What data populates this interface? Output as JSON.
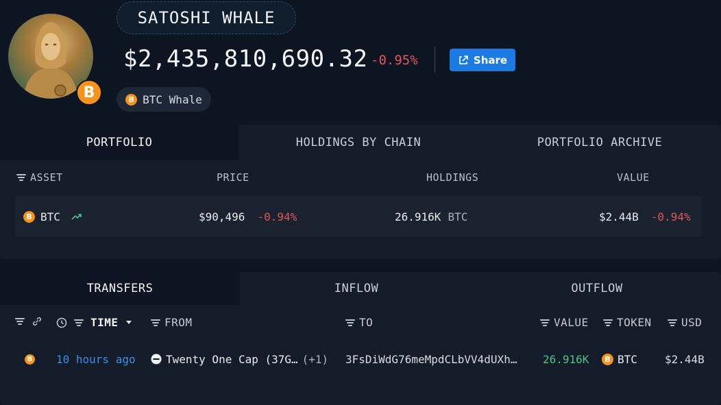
{
  "profile": {
    "name": "SATOSHI WHALE",
    "total_value": "$2,435,810,690.32",
    "total_change": "-0.95%",
    "share_label": "Share",
    "tag_label": "BTC Whale",
    "badge_symbol": "B"
  },
  "portfolio_tabs": [
    "PORTFOLIO",
    "HOLDINGS BY CHAIN",
    "PORTFOLIO ARCHIVE"
  ],
  "portfolio_headers": {
    "asset": "ASSET",
    "price": "PRICE",
    "holdings": "HOLDINGS",
    "value": "VALUE"
  },
  "assets": [
    {
      "symbol": "BTC",
      "price": "$90,496",
      "price_change": "-0.94%",
      "holdings": "26.916K",
      "holdings_unit": "BTC",
      "value": "$2.44B",
      "value_change": "-0.94%"
    }
  ],
  "transfer_tabs": [
    "TRANSFERS",
    "INFLOW",
    "OUTFLOW"
  ],
  "transfer_headers": {
    "time": "TIME",
    "from": "FROM",
    "to": "TO",
    "value": "VALUE",
    "token": "TOKEN",
    "usd": "USD"
  },
  "transfers": [
    {
      "time": "10 hours ago",
      "from": "Twenty One Cap (37G…",
      "from_extra": "(+1)",
      "to": "3FsDiWdG76meMpdCLbVV4dUXh…",
      "value": "26.916K",
      "token": "BTC",
      "usd": "$2.44B"
    }
  ],
  "colors": {
    "accent": "#1c7be2",
    "negative": "#e0575b",
    "positive": "#4cc38a",
    "bitcoin": "#f7931a"
  }
}
